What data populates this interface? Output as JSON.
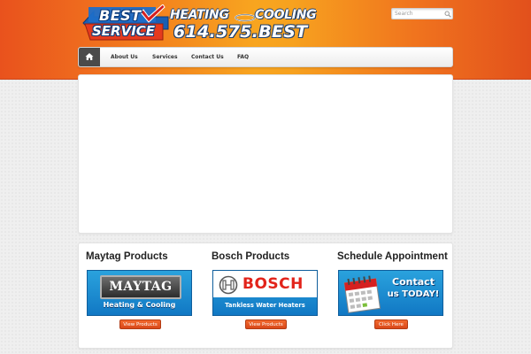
{
  "header": {
    "logo": {
      "best": "BEST",
      "service": "SERVICE",
      "heating": "HEATING",
      "cooling": "COOLING",
      "phone": "614.575.BEST"
    },
    "search": {
      "placeholder": "Search"
    }
  },
  "nav": {
    "home_icon": "home-icon",
    "items": [
      {
        "label": "About Us"
      },
      {
        "label": "Services"
      },
      {
        "label": "Contact Us"
      },
      {
        "label": "FAQ"
      }
    ]
  },
  "widgets": [
    {
      "title": "Maytag Products",
      "banner": {
        "brand": "MAYTAG",
        "subtitle": "Heating & Cooling"
      },
      "button": "View Products"
    },
    {
      "title": "Bosch Products",
      "banner": {
        "brand": "BOSCH",
        "subtitle": "Tankless Water Heaters"
      },
      "button": "View Products"
    },
    {
      "title": "Schedule Appointment",
      "banner": {
        "line1": "Contact",
        "line2": "us TODAY!"
      },
      "button": "Click Here"
    }
  ],
  "colors": {
    "header_orange": "#f27a1e",
    "button_orange": "#e0531f",
    "banner_blue": "#1a8fd3",
    "nav_home_dark": "#4a4a4a"
  }
}
